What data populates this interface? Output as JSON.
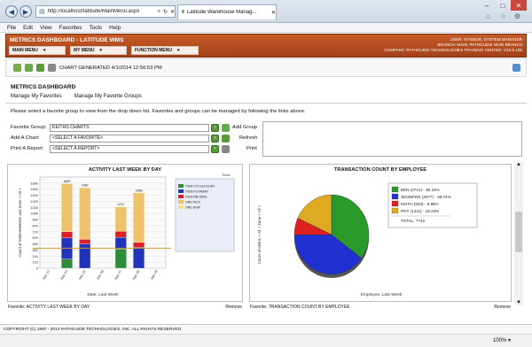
{
  "browser": {
    "url": "http://localhost/latitude/MainMenu.aspx",
    "tab_title": "Latitude Warehouse Manag...",
    "menu": [
      "File",
      "Edit",
      "View",
      "Favorites",
      "Tools",
      "Help"
    ]
  },
  "app": {
    "title": "METRICS DASHBOARD - LATITUDE WMS",
    "user_line": "USER: SYSMGR, SYSTEM MANAGER",
    "branch_line": "BRANCH: MAIN, PATHGUIDE MAIN BRANCH",
    "company_line": "COMPANY: PATHGUIDE TECHNOLOGIES TRAINING CENTER, V10.0.105",
    "menus": [
      "MAIN MENU",
      "MY MENU",
      "FUNCTION MENU"
    ]
  },
  "toolbar": {
    "chart_generated": "CHART GENERATED 4/1/2014 12:56:53 PM"
  },
  "page": {
    "title": "METRICS DASHBOARD",
    "links": [
      "Manage My Favorites",
      "Manage My Favorite Groups"
    ],
    "instructions": "Please select a favorite group to view from the drop down list. Favorites and groups can be managed by following the links above.",
    "favorite_group_label": "Favorite Group:",
    "favorite_group_value": "KEITHS CHARTS",
    "add_chart_label": "Add A Chart:",
    "add_chart_value": "<SELECT A FAVORITE>",
    "print_report_label": "Print A Report:",
    "print_report_value": "<SELECT A REPORT>",
    "add_group": "Add Group",
    "refresh": "Refresh",
    "print": "Print"
  },
  "panel_left": {
    "title": "ACTIVITY LAST WEEK BY DAY",
    "footer": "Favorite: ACTIVITY LAST WEEK BY DAY",
    "remove": "Remove"
  },
  "panel_right": {
    "title": "TRANSACTION COUNT BY EMPLOYEE",
    "footer": "Favorite: TRANSACTION COUNT BY EMPLOYEE",
    "remove": "Remove"
  },
  "chart_data": [
    {
      "type": "bar",
      "title": "ACTIVITY LAST WEEK BY DAY",
      "xlabel": "Date, Last Week",
      "ylabel": "Count of SelectedMetric and Zone < All >",
      "ylim": [
        0,
        1800
      ],
      "yticks": [
        "0",
        "120",
        "240",
        "360",
        "480",
        "600",
        "720",
        "840",
        "960",
        "1080",
        "1200",
        "1320",
        "1440",
        "1560",
        "1680"
      ],
      "categories": [
        "Mar 23",
        "Mar 24",
        "Mar 25",
        "Mar 26",
        "Mar 27",
        "Mar 28",
        "Mar 29"
      ],
      "totals": [
        "",
        "1669",
        "1587",
        "",
        "1211",
        "1488",
        ""
      ],
      "series": [
        {
          "name": "ITEM CYCLECOUNT",
          "color": "#2e8b3a",
          "values": [
            0,
            180,
            0,
            0,
            380,
            0,
            0
          ]
        },
        {
          "name": "ITEM PUTAWAY",
          "color": "#2233bb",
          "values": [
            0,
            420,
            480,
            0,
            230,
            410,
            0
          ]
        },
        {
          "name": "ITEM RECEIVE",
          "color": "#d8202a",
          "values": [
            0,
            120,
            90,
            0,
            120,
            100,
            0
          ]
        },
        {
          "name": "ORD PICK",
          "color": "#eec26a",
          "values": [
            0,
            949,
            1017,
            0,
            481,
            978,
            0
          ]
        },
        {
          "name": "ORD SHIP",
          "color": "#f0e08a",
          "values": [
            0,
            0,
            0,
            0,
            0,
            0,
            0
          ]
        }
      ],
      "legend_title": "Trend"
    },
    {
      "type": "pie",
      "title": "TRANSACTION COUNT BY EMPLOYEE",
      "xlabel": "Employee, Last Week",
      "ylabel": "Count of Metric < All > Zone < All >",
      "slices": [
        {
          "label": "BEN (2721) - 35.15%",
          "value": 2721,
          "color": "#2a9a2a"
        },
        {
          "label": "JENNIFER (3077) - 39.74%",
          "value": 3077,
          "color": "#1f2fd0"
        },
        {
          "label": "KEITH (533) - 6.88%",
          "value": 533,
          "color": "#e02020"
        },
        {
          "label": "PGT (1411) - 18.23%",
          "value": 1411,
          "color": "#ddaa22"
        }
      ],
      "total": "TOTAL: 7742"
    }
  ],
  "footer": {
    "copyright": "COPYRIGHT (C) 1997 - 2013 PATHGUIDE TECHNOLOGIES, INC. ALL RIGHTS RESERVED.",
    "zoom": "100%"
  }
}
